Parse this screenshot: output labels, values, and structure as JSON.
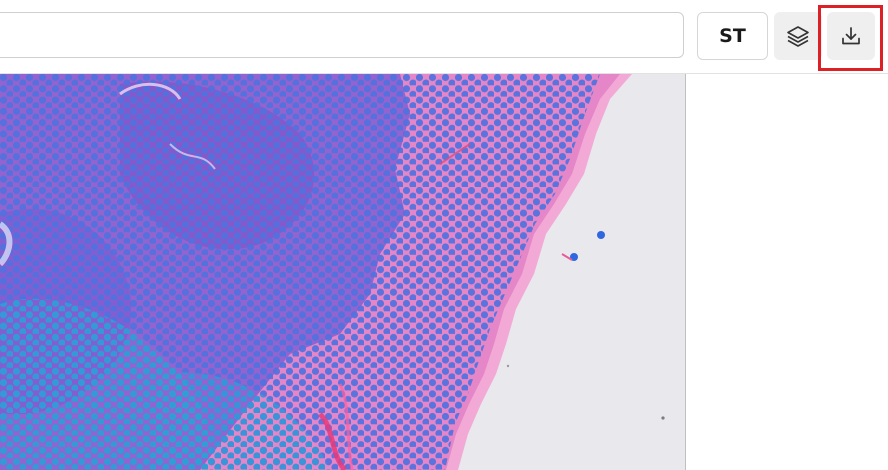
{
  "toolbar": {
    "search": {
      "value": "",
      "placeholder": ""
    },
    "st_button": {
      "label": "ST"
    },
    "layers_button": {
      "icon": "layers-icon"
    },
    "download_button": {
      "icon": "download-icon"
    },
    "highlight_color": "#dd1f26"
  },
  "viewer": {
    "content": "tissue-image",
    "colors": {
      "background": "#e9e8ec",
      "tissue_pink": "#e586c8",
      "tissue_edge": "#f2a9d6",
      "tissue_purple": "#8a5fd0",
      "spot_blue": "#4f72df",
      "spot_cyan": "#2ea0d6"
    }
  }
}
